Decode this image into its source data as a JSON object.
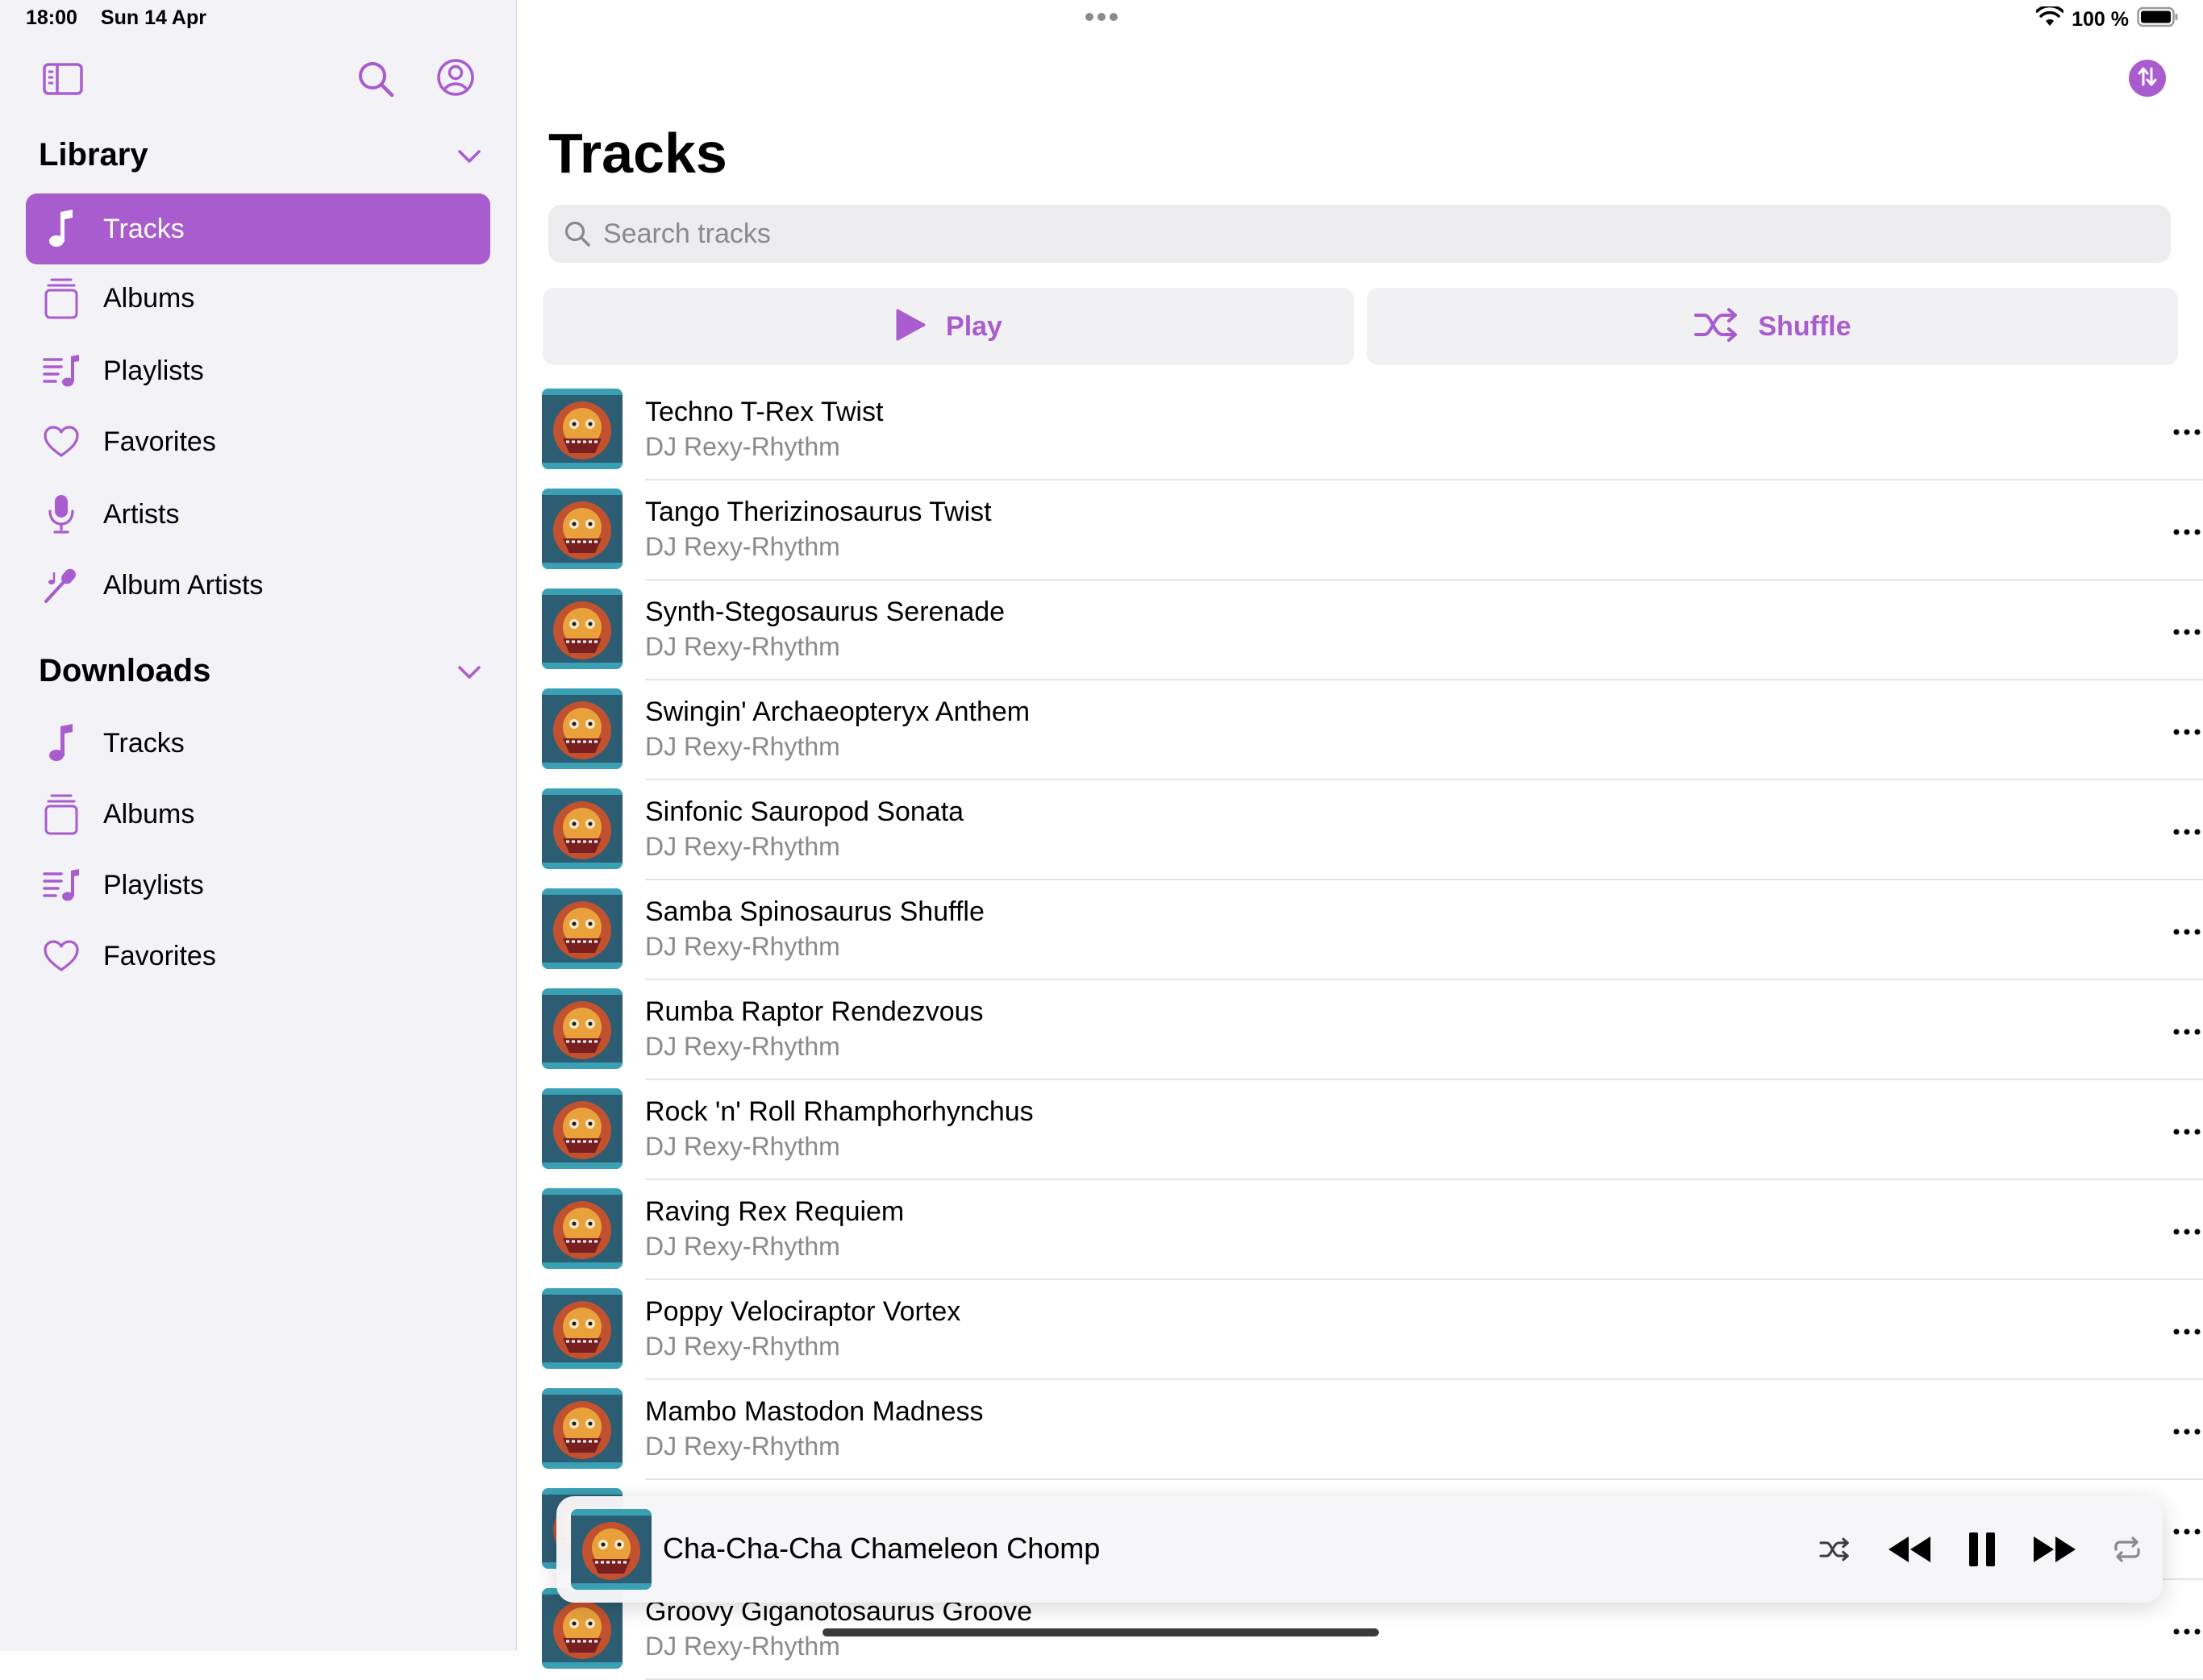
{
  "status_bar": {
    "time": "18:00",
    "date": "Sun 14 Apr",
    "battery": "100 %"
  },
  "colors": {
    "accent": "#a95ccd",
    "sidebar_bg": "#f2f2f7",
    "secondary_text": "#8a8a8e"
  },
  "sidebar": {
    "icons": [
      "sidebar-toggle-icon",
      "search-icon",
      "account-icon"
    ],
    "library": {
      "title": "Library",
      "items": [
        {
          "label": "Tracks",
          "icon": "music-note-icon",
          "active": true
        },
        {
          "label": "Albums",
          "icon": "album-stack-icon"
        },
        {
          "label": "Playlists",
          "icon": "playlist-icon"
        },
        {
          "label": "Favorites",
          "icon": "heart-icon"
        },
        {
          "label": "Artists",
          "icon": "microphone-icon"
        },
        {
          "label": "Album Artists",
          "icon": "music-mic-icon"
        }
      ]
    },
    "downloads": {
      "title": "Downloads",
      "items": [
        {
          "label": "Tracks",
          "icon": "music-note-icon"
        },
        {
          "label": "Albums",
          "icon": "album-stack-icon"
        },
        {
          "label": "Playlists",
          "icon": "playlist-icon"
        },
        {
          "label": "Favorites",
          "icon": "heart-icon"
        }
      ]
    }
  },
  "main": {
    "title": "Tracks",
    "search_placeholder": "Search tracks",
    "play_label": "Play",
    "shuffle_label": "Shuffle",
    "tracks": [
      {
        "name": "Techno T-Rex Twist",
        "artist": "DJ Rexy-Rhythm"
      },
      {
        "name": "Tango Therizinosaurus Twist",
        "artist": "DJ Rexy-Rhythm"
      },
      {
        "name": "Synth-Stegosaurus Serenade",
        "artist": "DJ Rexy-Rhythm"
      },
      {
        "name": "Swingin' Archaeopteryx Anthem",
        "artist": "DJ Rexy-Rhythm"
      },
      {
        "name": "Sinfonic Sauropod Sonata",
        "artist": "DJ Rexy-Rhythm"
      },
      {
        "name": "Samba Spinosaurus Shuffle",
        "artist": "DJ Rexy-Rhythm"
      },
      {
        "name": "Rumba Raptor Rendezvous",
        "artist": "DJ Rexy-Rhythm"
      },
      {
        "name": "Rock 'n' Roll Rhamphorhynchus",
        "artist": "DJ Rexy-Rhythm"
      },
      {
        "name": "Raving Rex Requiem",
        "artist": "DJ Rexy-Rhythm"
      },
      {
        "name": "Poppy Velociraptor Vortex",
        "artist": "DJ Rexy-Rhythm"
      },
      {
        "name": "Mambo Mastodon Madness",
        "artist": "DJ Rexy-Rhythm"
      },
      {
        "name": "",
        "artist": ""
      },
      {
        "name": "Groovy Giganotosaurus Groove",
        "artist": "DJ Rexy-Rhythm"
      }
    ]
  },
  "mini_player": {
    "title": "Cha-Cha-Cha Chameleon Chomp",
    "controls": [
      "shuffle-icon",
      "rewind-icon",
      "pause-icon",
      "fast-forward-icon",
      "repeat-icon"
    ]
  }
}
